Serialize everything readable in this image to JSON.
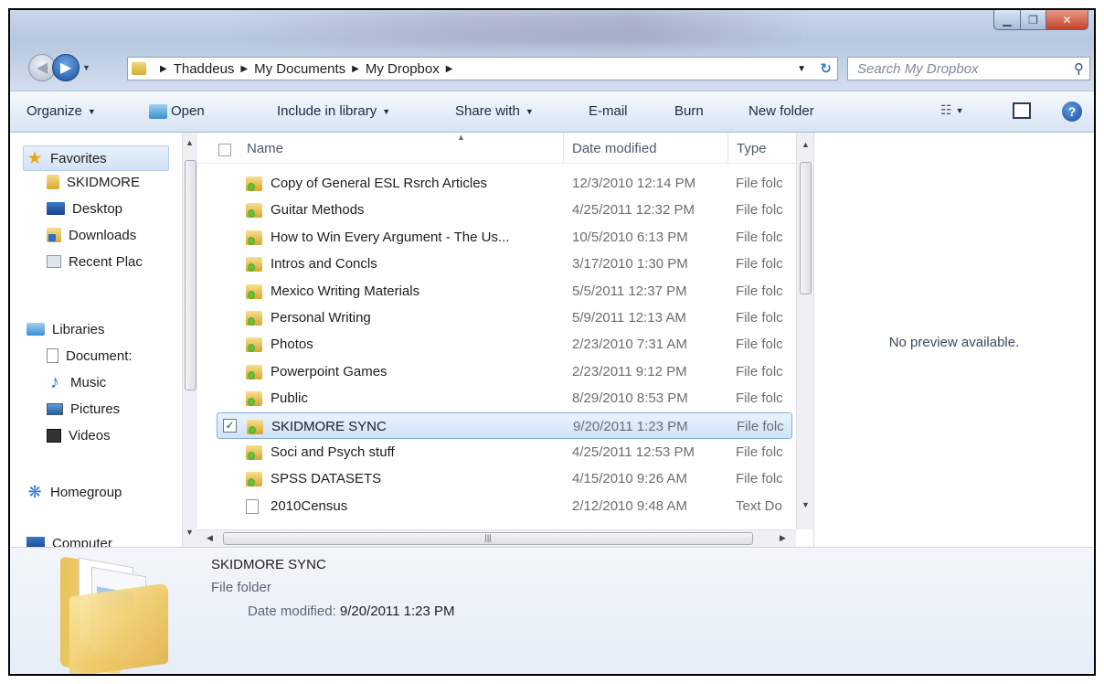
{
  "window": {
    "address": {
      "crumbs": [
        "Thaddeus",
        "My Documents",
        "My Dropbox"
      ]
    },
    "search": {
      "placeholder": "Search My Dropbox"
    }
  },
  "toolbar": {
    "organize": "Organize",
    "open": "Open",
    "include_in_library": "Include in library",
    "share_with": "Share with",
    "email": "E-mail",
    "burn": "Burn",
    "new_folder": "New folder"
  },
  "nav": {
    "favorites": "Favorites",
    "fav_items": [
      "SKIDMORE",
      "Desktop",
      "Downloads",
      "Recent Plac"
    ],
    "libraries": "Libraries",
    "lib_items": [
      "Document:",
      "Music",
      "Pictures",
      "Videos"
    ],
    "homegroup": "Homegroup",
    "computer": "Computer"
  },
  "columns": {
    "name": "Name",
    "date": "Date modified",
    "type": "Type"
  },
  "files": [
    {
      "name": "Copy of General ESL Rsrch Articles",
      "date": "12/3/2010 12:14 PM",
      "type": "File folc",
      "icon": "folder-icon"
    },
    {
      "name": "Guitar Methods",
      "date": "4/25/2011 12:32 PM",
      "type": "File folc",
      "icon": "folder-icon"
    },
    {
      "name": "How to Win Every Argument - The Us...",
      "date": "10/5/2010 6:13 PM",
      "type": "File folc",
      "icon": "folder-icon"
    },
    {
      "name": "Intros and Concls",
      "date": "3/17/2010 1:30 PM",
      "type": "File folc",
      "icon": "folder-icon"
    },
    {
      "name": "Mexico Writing Materials",
      "date": "5/5/2011 12:37 PM",
      "type": "File folc",
      "icon": "folder-icon"
    },
    {
      "name": "Personal Writing",
      "date": "5/9/2011 12:13 AM",
      "type": "File folc",
      "icon": "folder-icon"
    },
    {
      "name": "Photos",
      "date": "2/23/2010 7:31 AM",
      "type": "File folc",
      "icon": "folder-icon"
    },
    {
      "name": "Powerpoint Games",
      "date": "2/23/2011 9:12 PM",
      "type": "File folc",
      "icon": "folder-icon"
    },
    {
      "name": "Public",
      "date": "8/29/2010 8:53 PM",
      "type": "File folc",
      "icon": "folder-icon"
    },
    {
      "name": "SKIDMORE SYNC",
      "date": "9/20/2011 1:23 PM",
      "type": "File folc",
      "icon": "folder-icon",
      "selected": true
    },
    {
      "name": "Soci and Psych stuff",
      "date": "4/25/2011 12:53 PM",
      "type": "File folc",
      "icon": "folder-icon"
    },
    {
      "name": "SPSS DATASETS",
      "date": "4/15/2010 9:26 AM",
      "type": "File folc",
      "icon": "folder-icon"
    },
    {
      "name": "2010Census",
      "date": "2/12/2010 9:48 AM",
      "type": "Text Do",
      "icon": "text-file-icon"
    }
  ],
  "preview": {
    "message": "No preview available."
  },
  "details": {
    "name": "SKIDMORE SYNC",
    "type": "File folder",
    "modified_label": "Date modified:",
    "modified_value": "9/20/2011 1:23 PM"
  }
}
